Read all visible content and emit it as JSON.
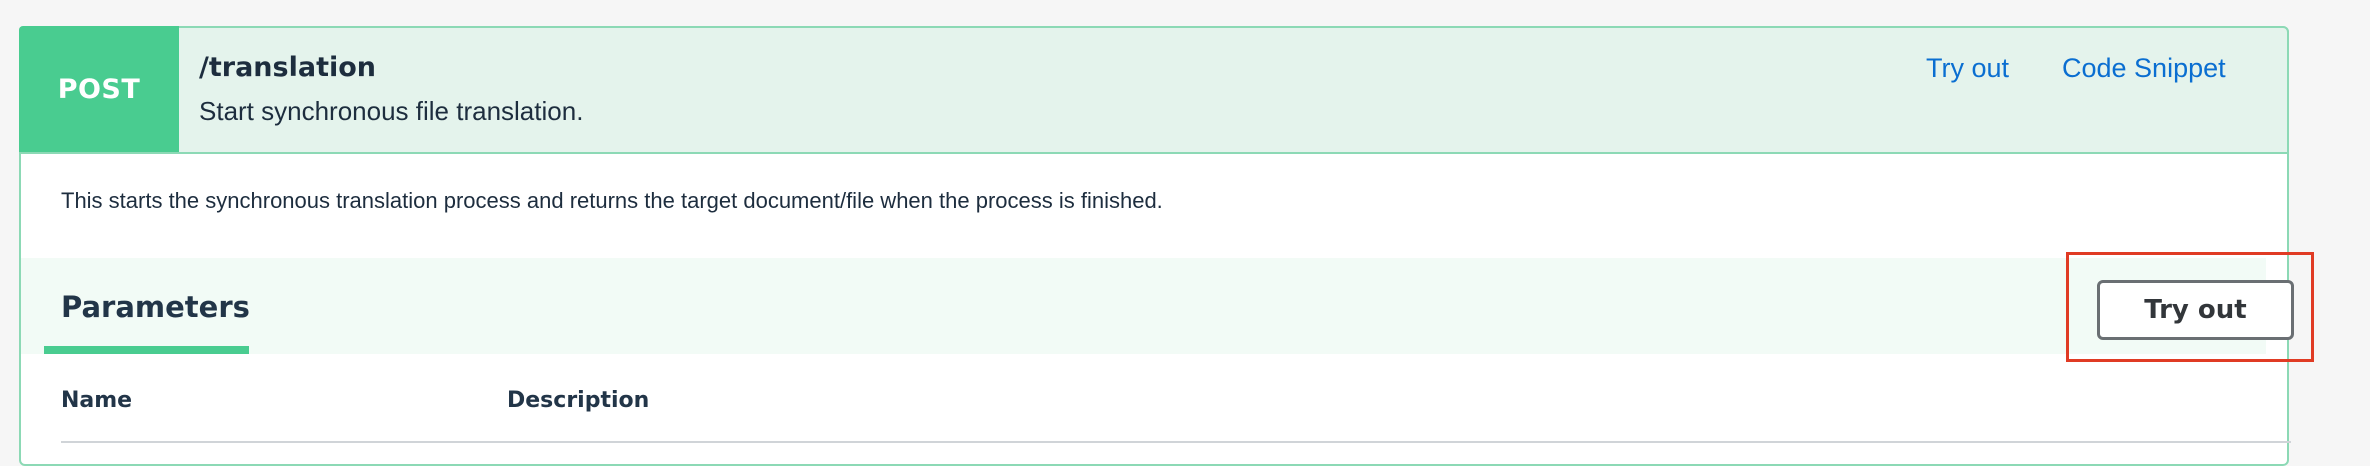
{
  "operation": {
    "method": "POST",
    "path": "/translation",
    "summary": "Start synchronous file translation.",
    "description": "This starts the synchronous translation process and returns the target document/file when the process is finished.",
    "links": {
      "try_out": "Try out",
      "code_snippet": "Code Snippet"
    }
  },
  "parameters": {
    "title": "Parameters",
    "try_out_button": "Try out",
    "columns": {
      "name": "Name",
      "description": "Description"
    }
  },
  "colors": {
    "method_post": "#49cc90",
    "header_bg": "#e4f3ec",
    "link": "#0a6ed1",
    "highlight": "#e03b24"
  }
}
